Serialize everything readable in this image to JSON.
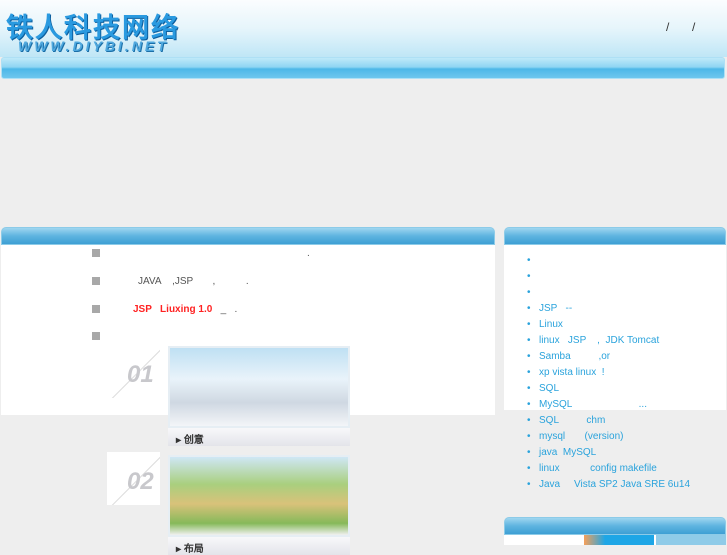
{
  "header": {
    "logo_text": "铁人科技网络",
    "logo_url_text": "WWW.DIYBI.NET",
    "separators": [
      "/",
      "/"
    ]
  },
  "left_list": [
    {
      "text": "."
    },
    {
      "text": "JAVA    ,JSP       ,           ."
    },
    {
      "red": "JSP   Liuxing 1.0",
      "rest": "   _   ."
    },
    {
      "text": ""
    }
  ],
  "showcase": [
    {
      "number": "01",
      "caption": "创意"
    },
    {
      "number": "02",
      "caption": "布局"
    }
  ],
  "right_list": [
    "",
    "",
    "",
    "JSP   --",
    "Linux",
    "linux   JSP    ,  JDK Tomcat",
    "Samba          ,or",
    "xp vista linux  !",
    "SQL",
    "MySQL                        ...",
    "SQL          chm",
    "mysql       (version)",
    "java  MySQL",
    "linux           config makefile",
    "Java     Vista SP2 Java SRE 6u14"
  ],
  "colors": {
    "accent": "#2aa3dc",
    "red": "#ff2222",
    "bg": "#eeeeee"
  }
}
